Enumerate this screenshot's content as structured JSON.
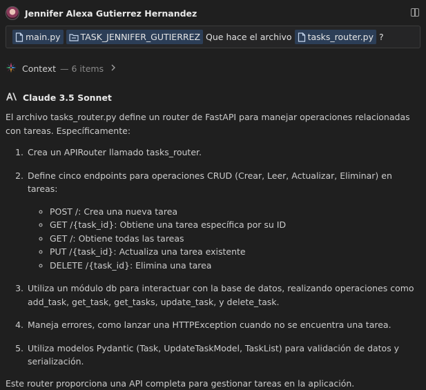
{
  "header": {
    "user_name": "Jennifer Alexa Gutierrez Hernandez",
    "avatar_icon": "user-avatar",
    "panel_icon": "split-panel-icon"
  },
  "prompt": {
    "chips": [
      {
        "icon": "file-icon",
        "label": "main.py"
      },
      {
        "icon": "folder-icon",
        "label": "TASK_JENNIFER_GUTIERREZ"
      }
    ],
    "text": "Que hace el archivo",
    "file_chip": {
      "icon": "file-icon",
      "label": "tasks_router.py"
    },
    "suffix": "?"
  },
  "context": {
    "icon": "sparkle-icon",
    "label": "Context",
    "count": "— 6 items",
    "chevron_icon": "chevron-right-icon"
  },
  "model": {
    "icon": "anthropic-logo-icon",
    "name": "Claude 3.5 Sonnet"
  },
  "response": {
    "intro": "El archivo tasks_router.py define un router de FastAPI para manejar operaciones relacionadas con tareas. Específicamente:",
    "steps": [
      "Crea un APIRouter llamado tasks_router.",
      "Define cinco endpoints para operaciones CRUD (Crear, Leer, Actualizar, Eliminar) en tareas:",
      "Utiliza un módulo db para interactuar con la base de datos, realizando operaciones como add_task, get_task, get_tasks, update_task, y delete_task.",
      "Maneja errores, como lanzar una HTTPException cuando no se encuentra una tarea.",
      "Utiliza modelos Pydantic (Task, UpdateTaskModel, TaskList) para validación de datos y serialización."
    ],
    "endpoints": [
      "POST /: Crea una nueva tarea",
      "GET /{task_id}: Obtiene una tarea específica por su ID",
      "GET /: Obtiene todas las tareas",
      "PUT /{task_id}: Actualiza una tarea existente",
      "DELETE /{task_id}: Elimina una tarea"
    ],
    "conclusion": "Este router proporciona una API completa para gestionar tareas en la aplicación."
  },
  "colors": {
    "background": "#1f1f1f",
    "chip_background": "#2c3e57",
    "text": "#cccccc",
    "sparkle": [
      "#e8508a",
      "#4aa3ff",
      "#f0a030",
      "#40c080"
    ]
  }
}
